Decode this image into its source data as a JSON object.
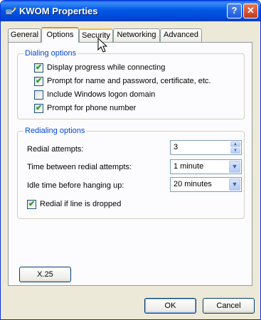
{
  "window": {
    "title": "KWOM Properties",
    "help_label": "?",
    "close_label": "✕"
  },
  "tabs": [
    {
      "label": "General"
    },
    {
      "label": "Options"
    },
    {
      "label": "Security"
    },
    {
      "label": "Networking"
    },
    {
      "label": "Advanced"
    }
  ],
  "active_tab": "Options",
  "dialing": {
    "title": "Dialing options",
    "items": [
      {
        "label": "Display progress while connecting",
        "checked": true,
        "mark": "✔"
      },
      {
        "label": "Prompt for name and password, certificate, etc.",
        "checked": true,
        "mark": "✔"
      },
      {
        "label": "Include Windows logon domain",
        "checked": false,
        "mark": ""
      },
      {
        "label": "Prompt for phone number",
        "checked": true,
        "mark": "✔"
      }
    ]
  },
  "redialing": {
    "title": "Redialing options",
    "attempts_label": "Redial attempts:",
    "attempts_value": "3",
    "between_label": "Time between redial attempts:",
    "between_value": "1 minute",
    "idle_label": "Idle time before hanging up:",
    "idle_value": "20 minutes",
    "redial_dropped_label": "Redial if line is dropped",
    "redial_dropped_checked": true,
    "redial_dropped_mark": "✔"
  },
  "x25_label": "X.25",
  "ok_label": "OK",
  "cancel_label": "Cancel",
  "colors": {
    "titlebar": "#0058e6",
    "group_title": "#0046d5",
    "active_tab_accent": "#e68b2c",
    "check": "#21a121"
  },
  "icons": {
    "title": "network-connection-icon",
    "spin_up": "▲",
    "spin_down": "▼",
    "dropdown": "▼"
  }
}
